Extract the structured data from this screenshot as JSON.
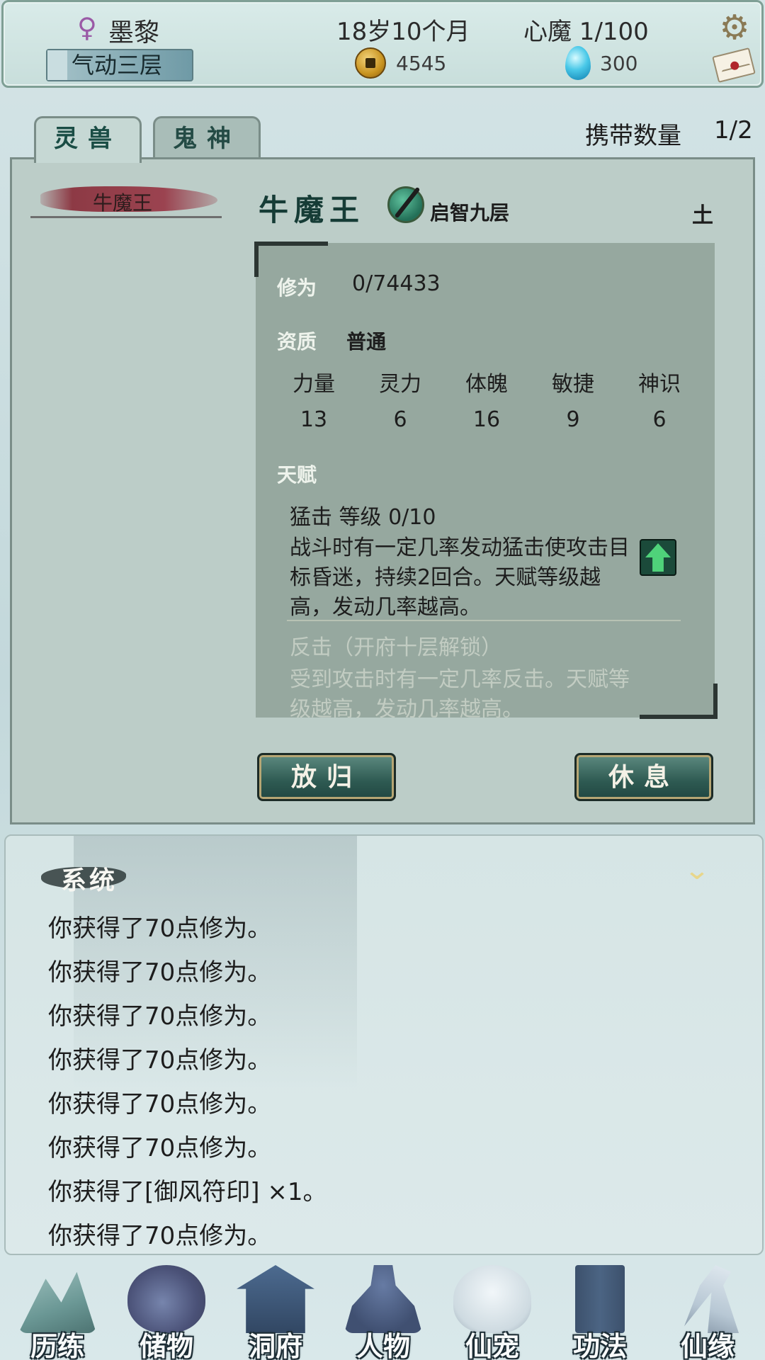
{
  "header": {
    "gender_symbol": "♀",
    "name": "墨黎",
    "realm": "气动三层",
    "age": "18岁10个月",
    "heart_demon": "心魔  1/100",
    "coins": "4545",
    "gems": "300",
    "settings_icon": "gear-icon",
    "mail_icon": "mail-icon"
  },
  "tabs": [
    {
      "label": "灵兽",
      "active": true
    },
    {
      "label": "鬼神",
      "active": false
    }
  ],
  "carry": {
    "label": "携带数量",
    "value": "1/2"
  },
  "pet_list": [
    {
      "name": "牛魔王",
      "selected": true
    }
  ],
  "pet": {
    "name": "牛魔王",
    "level": "启智九层",
    "element": "土",
    "cultivation_label": "修为",
    "cultivation_value": "0/74433",
    "aptitude_label": "资质",
    "aptitude_value": "普通",
    "stats": [
      {
        "name": "力量",
        "value": "13"
      },
      {
        "name": "灵力",
        "value": "6"
      },
      {
        "name": "体魄",
        "value": "16"
      },
      {
        "name": "敏捷",
        "value": "9"
      },
      {
        "name": "神识",
        "value": "6"
      }
    ],
    "talent_label": "天赋",
    "talents": [
      {
        "name": "猛击   等级  0/10",
        "desc": "战斗时有一定几率发动猛击使攻击目标昏迷，持续2回合。天赋等级越高，发动几率越高。",
        "locked": false
      },
      {
        "name": "反击（开府十层解锁）",
        "desc": "受到攻击时有一定几率反击。天赋等级越高，发动几率越高。",
        "locked": true
      }
    ]
  },
  "actions": {
    "release": "放归",
    "rest": "休息"
  },
  "log": {
    "title": "系统",
    "collapse_icon": "chevron-double-down-icon",
    "lines": [
      "你获得了70点修为。",
      "你获得了70点修为。",
      "你获得了70点修为。",
      "你获得了70点修为。",
      "你获得了70点修为。",
      "你获得了70点修为。",
      "你获得了[御风符印] ×1。",
      "你获得了70点修为。"
    ]
  },
  "nav": [
    {
      "label": "历练",
      "icon": "mountain-icon",
      "color": "#5f8f8c"
    },
    {
      "label": "储物",
      "icon": "bag-icon",
      "color": "#4a4a6a"
    },
    {
      "label": "洞府",
      "icon": "pavilion-icon",
      "color": "#2f4a6e"
    },
    {
      "label": "人物",
      "icon": "person-icon",
      "color": "#3a4f7a"
    },
    {
      "label": "仙宠",
      "icon": "ghost-pet-icon",
      "color": "#d8e4ea"
    },
    {
      "label": "功法",
      "icon": "book-icon",
      "color": "#3c5678"
    },
    {
      "label": "仙缘",
      "icon": "crane-icon",
      "color": "#c7d3de"
    }
  ]
}
